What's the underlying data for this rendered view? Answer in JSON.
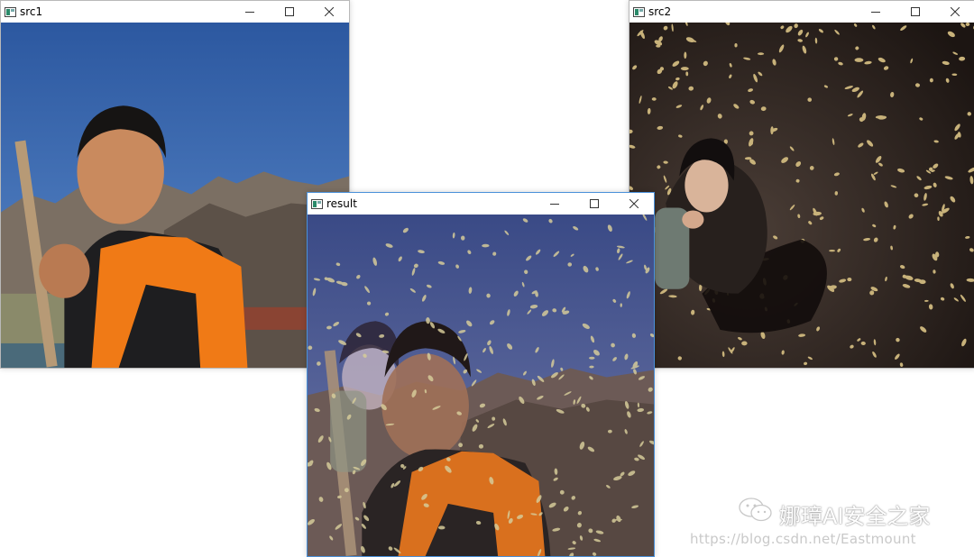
{
  "windows": {
    "src1": {
      "title": "src1"
    },
    "src2": {
      "title": "src2"
    },
    "result": {
      "title": "result"
    }
  },
  "watermark": {
    "brand": "娜璋AI安全之家",
    "url": "https://blog.csdn.net/Eastmount"
  },
  "icons": {
    "app": "window-app-icon",
    "minimize": "minimize-icon",
    "maximize": "maximize-icon",
    "close": "close-icon",
    "wechat": "wechat-icon"
  },
  "colors": {
    "active_border": "#4a90d9",
    "sky": "#2f5fa8",
    "vest": "#f07a16",
    "night_ground": "#2b211c"
  }
}
